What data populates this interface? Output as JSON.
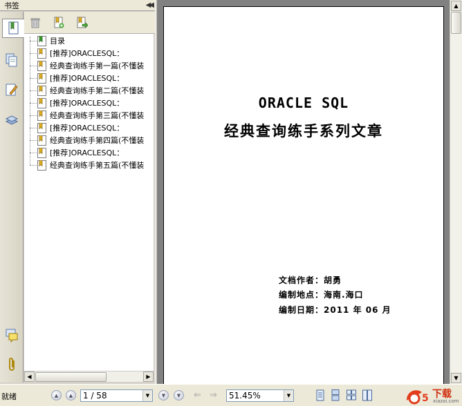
{
  "panel": {
    "title": "书签"
  },
  "bookmarks": [
    {
      "label": "目录",
      "type": "green"
    },
    {
      "label": "[推荐]ORACLESQL：",
      "type": "yellow"
    },
    {
      "label": "经典查询练手第一篇(不懂装",
      "type": "yellow"
    },
    {
      "label": "[推荐]ORACLESQL：",
      "type": "yellow"
    },
    {
      "label": "经典查询练手第二篇(不懂装",
      "type": "yellow"
    },
    {
      "label": "[推荐]ORACLESQL：",
      "type": "yellow"
    },
    {
      "label": "经典查询练手第三篇(不懂装",
      "type": "yellow"
    },
    {
      "label": "[推荐]ORACLESQL：",
      "type": "yellow"
    },
    {
      "label": "经典查询练手第四篇(不懂装",
      "type": "yellow"
    },
    {
      "label": "[推荐]ORACLESQL：",
      "type": "yellow"
    },
    {
      "label": "经典查询练手第五篇(不懂装",
      "type": "yellow"
    }
  ],
  "document": {
    "title_line1": "ORACLE SQL",
    "title_line2": "经典查询练手系列文章",
    "author": "文档作者：胡勇",
    "location": "编制地点：海南.海口",
    "date": "编制日期：2011 年 06 月"
  },
  "statusbar": {
    "status": "就绪",
    "page": "1 / 58",
    "zoom": "51.45%"
  },
  "logo": {
    "text": "下载",
    "domain": "xiazai.com"
  }
}
